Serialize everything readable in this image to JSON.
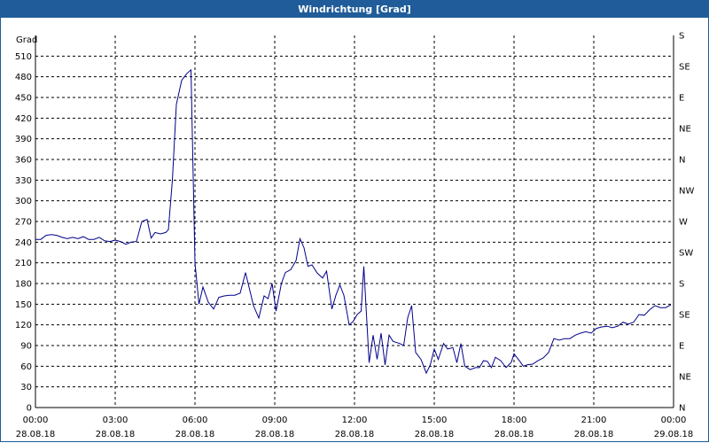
{
  "window": {
    "title": "Windrichtung [Grad]"
  },
  "colors": {
    "titlebar": "#1f5c99",
    "line": "#00008b",
    "grid": "#000000"
  },
  "chart_data": {
    "type": "line",
    "title": "Windrichtung [Grad]",
    "ylabel": "Grad",
    "ylim": [
      0,
      540
    ],
    "yticks": [
      0,
      30,
      60,
      90,
      120,
      150,
      180,
      210,
      240,
      270,
      300,
      330,
      360,
      390,
      420,
      450,
      480,
      510
    ],
    "y_right_ticks": [
      {
        "value": 0,
        "label": "N"
      },
      {
        "value": 45,
        "label": "NE"
      },
      {
        "value": 90,
        "label": "E"
      },
      {
        "value": 135,
        "label": "SE"
      },
      {
        "value": 180,
        "label": "S"
      },
      {
        "value": 225,
        "label": "SW"
      },
      {
        "value": 270,
        "label": "W"
      },
      {
        "value": 315,
        "label": "NW"
      },
      {
        "value": 360,
        "label": "N"
      },
      {
        "value": 405,
        "label": "NE"
      },
      {
        "value": 450,
        "label": "E"
      },
      {
        "value": 495,
        "label": "SE"
      },
      {
        "value": 540,
        "label": "S"
      }
    ],
    "xlim_hours": [
      0,
      24
    ],
    "xticks": [
      {
        "hour": 0,
        "time": "00:00",
        "date": "28.08.18"
      },
      {
        "hour": 3,
        "time": "03:00",
        "date": "28.08.18"
      },
      {
        "hour": 6,
        "time": "06:00",
        "date": "28.08.18"
      },
      {
        "hour": 9,
        "time": "09:00",
        "date": "28.08.18"
      },
      {
        "hour": 12,
        "time": "12:00",
        "date": "28.08.18"
      },
      {
        "hour": 15,
        "time": "15:00",
        "date": "28.08.18"
      },
      {
        "hour": 18,
        "time": "18:00",
        "date": "28.08.18"
      },
      {
        "hour": 21,
        "time": "21:00",
        "date": "28.08.18"
      },
      {
        "hour": 24,
        "time": "00:00",
        "date": "29.08.18"
      }
    ],
    "grid": true,
    "series": [
      {
        "points": [
          [
            0.0,
            244
          ],
          [
            0.2,
            244
          ],
          [
            0.4,
            250
          ],
          [
            0.6,
            251
          ],
          [
            0.8,
            250
          ],
          [
            1.0,
            247
          ],
          [
            1.2,
            245
          ],
          [
            1.4,
            247
          ],
          [
            1.6,
            245
          ],
          [
            1.8,
            248
          ],
          [
            2.0,
            244
          ],
          [
            2.2,
            244
          ],
          [
            2.4,
            247
          ],
          [
            2.6,
            242
          ],
          [
            2.8,
            241
          ],
          [
            3.0,
            243
          ],
          [
            3.2,
            241
          ],
          [
            3.4,
            237
          ],
          [
            3.6,
            240
          ],
          [
            3.8,
            241
          ],
          [
            4.0,
            270
          ],
          [
            4.2,
            273
          ],
          [
            4.35,
            246
          ],
          [
            4.5,
            254
          ],
          [
            4.7,
            252
          ],
          [
            4.9,
            254
          ],
          [
            5.0,
            258
          ],
          [
            5.15,
            330
          ],
          [
            5.3,
            440
          ],
          [
            5.5,
            475
          ],
          [
            5.7,
            485
          ],
          [
            5.85,
            490
          ],
          [
            6.0,
            210
          ],
          [
            6.15,
            150
          ],
          [
            6.3,
            175
          ],
          [
            6.5,
            153
          ],
          [
            6.7,
            143
          ],
          [
            6.9,
            160
          ],
          [
            7.1,
            162
          ],
          [
            7.3,
            163
          ],
          [
            7.5,
            163
          ],
          [
            7.7,
            166
          ],
          [
            7.9,
            196
          ],
          [
            8.0,
            180
          ],
          [
            8.2,
            148
          ],
          [
            8.4,
            130
          ],
          [
            8.6,
            162
          ],
          [
            8.75,
            158
          ],
          [
            8.9,
            180
          ],
          [
            9.05,
            140
          ],
          [
            9.25,
            180
          ],
          [
            9.4,
            196
          ],
          [
            9.6,
            200
          ],
          [
            9.8,
            213
          ],
          [
            9.95,
            245
          ],
          [
            10.1,
            232
          ],
          [
            10.25,
            205
          ],
          [
            10.4,
            207
          ],
          [
            10.6,
            195
          ],
          [
            10.8,
            188
          ],
          [
            10.95,
            198
          ],
          [
            11.15,
            143
          ],
          [
            11.3,
            163
          ],
          [
            11.45,
            178
          ],
          [
            11.6,
            163
          ],
          [
            11.8,
            120
          ],
          [
            11.95,
            125
          ],
          [
            12.1,
            135
          ],
          [
            12.25,
            140
          ],
          [
            12.35,
            205
          ],
          [
            12.55,
            65
          ],
          [
            12.7,
            105
          ],
          [
            12.85,
            70
          ],
          [
            13.0,
            108
          ],
          [
            13.15,
            62
          ],
          [
            13.3,
            105
          ],
          [
            13.45,
            96
          ],
          [
            13.7,
            93
          ],
          [
            13.85,
            90
          ],
          [
            14.0,
            130
          ],
          [
            14.15,
            148
          ],
          [
            14.3,
            80
          ],
          [
            14.5,
            70
          ],
          [
            14.7,
            50
          ],
          [
            14.85,
            62
          ],
          [
            15.0,
            85
          ],
          [
            15.15,
            70
          ],
          [
            15.35,
            93
          ],
          [
            15.5,
            85
          ],
          [
            15.7,
            87
          ],
          [
            15.85,
            65
          ],
          [
            16.0,
            93
          ],
          [
            16.15,
            60
          ],
          [
            16.35,
            55
          ],
          [
            16.55,
            58
          ],
          [
            16.7,
            58
          ],
          [
            16.85,
            68
          ],
          [
            17.0,
            67
          ],
          [
            17.15,
            58
          ],
          [
            17.3,
            73
          ],
          [
            17.5,
            68
          ],
          [
            17.7,
            58
          ],
          [
            17.9,
            66
          ],
          [
            18.0,
            78
          ],
          [
            18.2,
            68
          ],
          [
            18.35,
            60
          ],
          [
            18.5,
            62
          ],
          [
            18.7,
            63
          ],
          [
            18.9,
            68
          ],
          [
            19.1,
            72
          ],
          [
            19.3,
            80
          ],
          [
            19.5,
            100
          ],
          [
            19.7,
            98
          ],
          [
            19.9,
            100
          ],
          [
            20.1,
            100
          ],
          [
            20.3,
            105
          ],
          [
            20.5,
            108
          ],
          [
            20.7,
            110
          ],
          [
            20.9,
            108
          ],
          [
            21.1,
            115
          ],
          [
            21.3,
            117
          ],
          [
            21.5,
            118
          ],
          [
            21.7,
            116
          ],
          [
            21.9,
            118
          ],
          [
            22.1,
            124
          ],
          [
            22.3,
            121
          ],
          [
            22.5,
            124
          ],
          [
            22.7,
            135
          ],
          [
            22.9,
            134
          ],
          [
            23.1,
            142
          ],
          [
            23.3,
            148
          ],
          [
            23.5,
            145
          ],
          [
            23.7,
            145
          ],
          [
            23.9,
            149
          ]
        ]
      }
    ]
  }
}
